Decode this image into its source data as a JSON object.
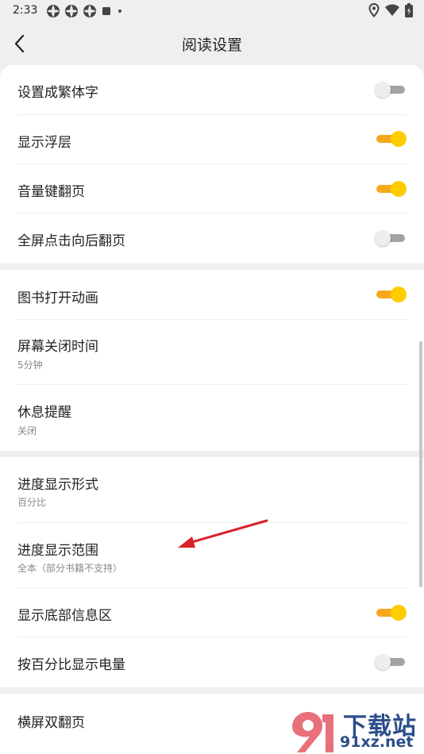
{
  "status_bar": {
    "time": "2:33",
    "left_icons": [
      "gear-app-icon",
      "gear-app-icon",
      "gear-app-icon",
      "square-app-icon",
      "dot-icon"
    ],
    "right_icons": [
      "location-icon",
      "wifi-icon",
      "battery-icon"
    ]
  },
  "header": {
    "title": "阅读设置",
    "back_icon": "chevron-left-icon"
  },
  "sections": [
    {
      "items": [
        {
          "label": "设置成繁体字",
          "toggle": "off"
        },
        {
          "label": "显示浮层",
          "toggle": "on"
        },
        {
          "label": "音量键翻页",
          "toggle": "on"
        },
        {
          "label": "全屏点击向后翻页",
          "toggle": "off"
        }
      ]
    },
    {
      "items": [
        {
          "label": "图书打开动画",
          "toggle": "on"
        },
        {
          "label": "屏幕关闭时间",
          "value": "5分钟"
        },
        {
          "label": "休息提醒",
          "value": "关闭"
        }
      ]
    },
    {
      "items": [
        {
          "label": "进度显示形式",
          "value": "百分比"
        },
        {
          "label": "进度显示范围",
          "value": "全本（部分书籍不支持）"
        },
        {
          "label": "显示底部信息区",
          "toggle": "on"
        },
        {
          "label": "按百分比显示电量",
          "toggle": "off"
        }
      ]
    },
    {
      "items": [
        {
          "label": "横屏双翻页"
        }
      ]
    }
  ],
  "colors": {
    "toggle_on_track": "#f6a81c",
    "toggle_on_knob": "#ffcc00",
    "toggle_off_track": "#a3a3a3",
    "background": "#efefef",
    "arrow": "#d9232a"
  },
  "watermark": {
    "logo_text": "下载站",
    "site_text": "91xz.net"
  }
}
